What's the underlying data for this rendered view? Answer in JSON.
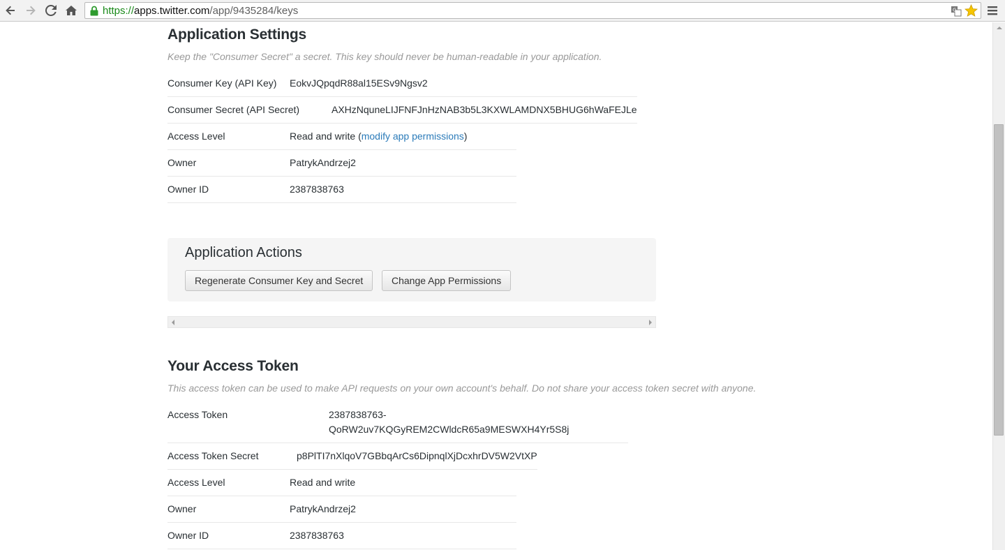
{
  "browser": {
    "url_protocol": "https://",
    "url_host": "apps.twitter.com",
    "url_path": "/app/9435284/keys"
  },
  "app_settings": {
    "title": "Application Settings",
    "description": "Keep the \"Consumer Secret\" a secret. This key should never be human-readable in your application.",
    "rows": [
      {
        "label": "Consumer Key (API Key)",
        "value": "EokvJQpqdR88al15ESv9Ngsv2"
      },
      {
        "label": "Consumer Secret (API Secret)",
        "value": "AXHzNquneLIJFNFJnHzNAB3b5L3KXWLAMDNX5BHUG6hWaFEJLe"
      },
      {
        "label": "Access Level",
        "value": "Read and write",
        "open_paren": "(",
        "link": "modify app permissions",
        "close_paren": ")"
      },
      {
        "label": "Owner",
        "value": "PatrykAndrzej2"
      },
      {
        "label": "Owner ID",
        "value": "2387838763"
      }
    ]
  },
  "app_actions": {
    "title": "Application Actions",
    "regenerate_label": "Regenerate Consumer Key and Secret",
    "change_permissions_label": "Change App Permissions"
  },
  "access_token": {
    "title": "Your Access Token",
    "description": "This access token can be used to make API requests on your own account's behalf. Do not share your access token secret with anyone.",
    "rows": [
      {
        "label": "Access Token",
        "value_line1": "2387838763-",
        "value_line2": "QoRW2uv7KQGyREM2CWldcR65a9MESWXH4Yr5S8j"
      },
      {
        "label": "Access Token Secret",
        "value": "p8PlTI7nXlqoV7GBbqArCs6DipnqlXjDcxhrDV5W2VtXP"
      },
      {
        "label": "Access Level",
        "value": "Read and write"
      },
      {
        "label": "Owner",
        "value": "PatrykAndrzej2"
      },
      {
        "label": "Owner ID",
        "value": "2387838763"
      }
    ]
  },
  "colors": {
    "link": "#2b7bb9",
    "muted_text": "#999999",
    "actions_bg": "#f5f5f5"
  }
}
